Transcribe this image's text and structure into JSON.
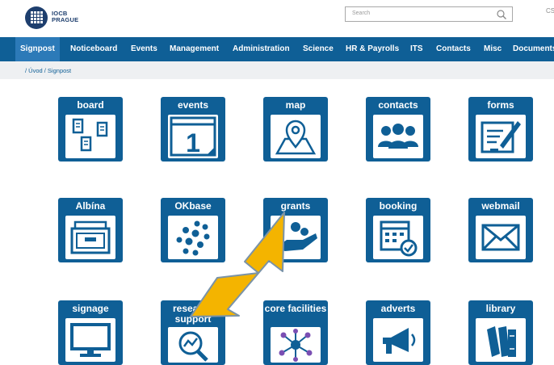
{
  "header": {
    "logo_line1": "IOCB",
    "logo_line2": "PRAGUE",
    "search_placeholder": "Search",
    "lang": "CS"
  },
  "nav": [
    {
      "label": "Signpost",
      "active": true
    },
    {
      "label": "Noticeboard"
    },
    {
      "label": "Events"
    },
    {
      "label": "Management"
    },
    {
      "label": "Administration"
    },
    {
      "label": "Science"
    },
    {
      "label": "HR & Payrolls"
    },
    {
      "label": "ITS"
    },
    {
      "label": "Contacts"
    },
    {
      "label": "Misc"
    },
    {
      "label": "Documents"
    }
  ],
  "breadcrumb": "/ Úvod / Signpost",
  "tiles": [
    {
      "label": "board",
      "icon": "board-icon"
    },
    {
      "label": "events",
      "icon": "calendar-icon",
      "icon_text": "1"
    },
    {
      "label": "map",
      "icon": "map-pin-icon"
    },
    {
      "label": "contacts",
      "icon": "people-icon"
    },
    {
      "label": "forms",
      "icon": "form-pen-icon"
    },
    {
      "label": "Albína",
      "icon": "archive-drawer-icon"
    },
    {
      "label": "OKbase",
      "icon": "dots-cluster-icon"
    },
    {
      "label": "grants",
      "icon": "hand-coins-icon"
    },
    {
      "label": "booking",
      "icon": "calendar-check-icon"
    },
    {
      "label": "webmail",
      "icon": "envelope-icon"
    },
    {
      "label": "signage",
      "icon": "monitor-icon"
    },
    {
      "label": "research support",
      "icon": "magnifier-chart-icon"
    },
    {
      "label": "core facilities",
      "icon": "network-icon"
    },
    {
      "label": "adverts",
      "icon": "megaphone-icon"
    },
    {
      "label": "library",
      "icon": "books-icon"
    }
  ],
  "colors": {
    "brand_blue": "#0f5f96",
    "active_tab": "#2c7ab8",
    "arrow_fill": "#f4b400"
  }
}
